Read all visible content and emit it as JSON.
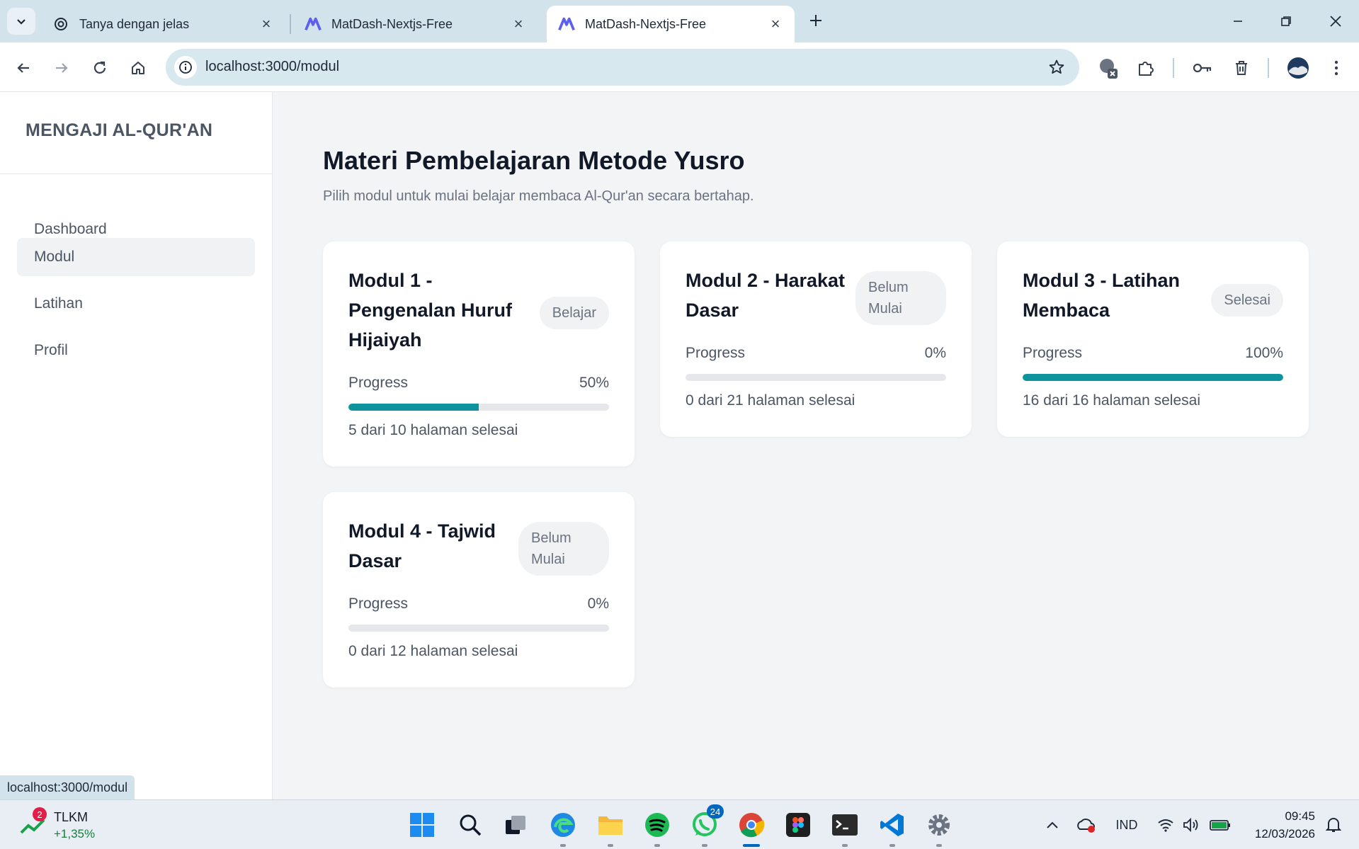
{
  "browser": {
    "tabs": [
      {
        "title": "Tanya dengan jelas",
        "favicon": "chatgpt-icon",
        "active": false
      },
      {
        "title": "MatDash-Nextjs-Free",
        "favicon": "matdash-icon",
        "active": false
      },
      {
        "title": "MatDash-Nextjs-Free",
        "favicon": "matdash-icon",
        "active": true
      }
    ],
    "url": "localhost:3000/modul",
    "status_url": "localhost:3000/modul"
  },
  "sidebar": {
    "brand": "MENGAJI AL-QUR'AN",
    "items": [
      {
        "label": "Dashboard",
        "active": false
      },
      {
        "label": "Modul",
        "active": true
      },
      {
        "label": "Latihan",
        "active": false
      },
      {
        "label": "Profil",
        "active": false
      }
    ]
  },
  "main": {
    "title": "Materi Pembelajaran Metode Yusro",
    "subtitle": "Pilih modul untuk mulai belajar membaca Al-Qur'an secara bertahap.",
    "progress_label": "Progress",
    "modules": [
      {
        "title": "Modul 1 - Pengenalan Huruf Hijaiyah",
        "status": "Belajar",
        "percent_label": "50%",
        "progress": 0.5,
        "count": "5 dari 10 halaman selesai"
      },
      {
        "title": "Modul 2 - Harakat Dasar",
        "status": "Belum Mulai",
        "percent_label": "0%",
        "progress": 0,
        "count": "0 dari 21 halaman selesai"
      },
      {
        "title": "Modul 3 - Latihan Membaca",
        "status": "Selesai",
        "percent_label": "100%",
        "progress": 1,
        "count": "16 dari 16 halaman selesai"
      },
      {
        "title": "Modul 4 - Tajwid Dasar",
        "status": "Belum Mulai",
        "percent_label": "0%",
        "progress": 0,
        "count": "0 dari 12 halaman selesai"
      }
    ]
  },
  "taskbar": {
    "stock": {
      "badge": "2",
      "ticker": "TLKM",
      "change": "+1,35%"
    },
    "whatsapp_count": "24",
    "language": "IND",
    "time": "09:45",
    "date": "12/03/2026"
  },
  "colors": {
    "accent": "#0e929b",
    "tabbar": "#d3e3ec",
    "page_bg": "#f3f4f6"
  }
}
